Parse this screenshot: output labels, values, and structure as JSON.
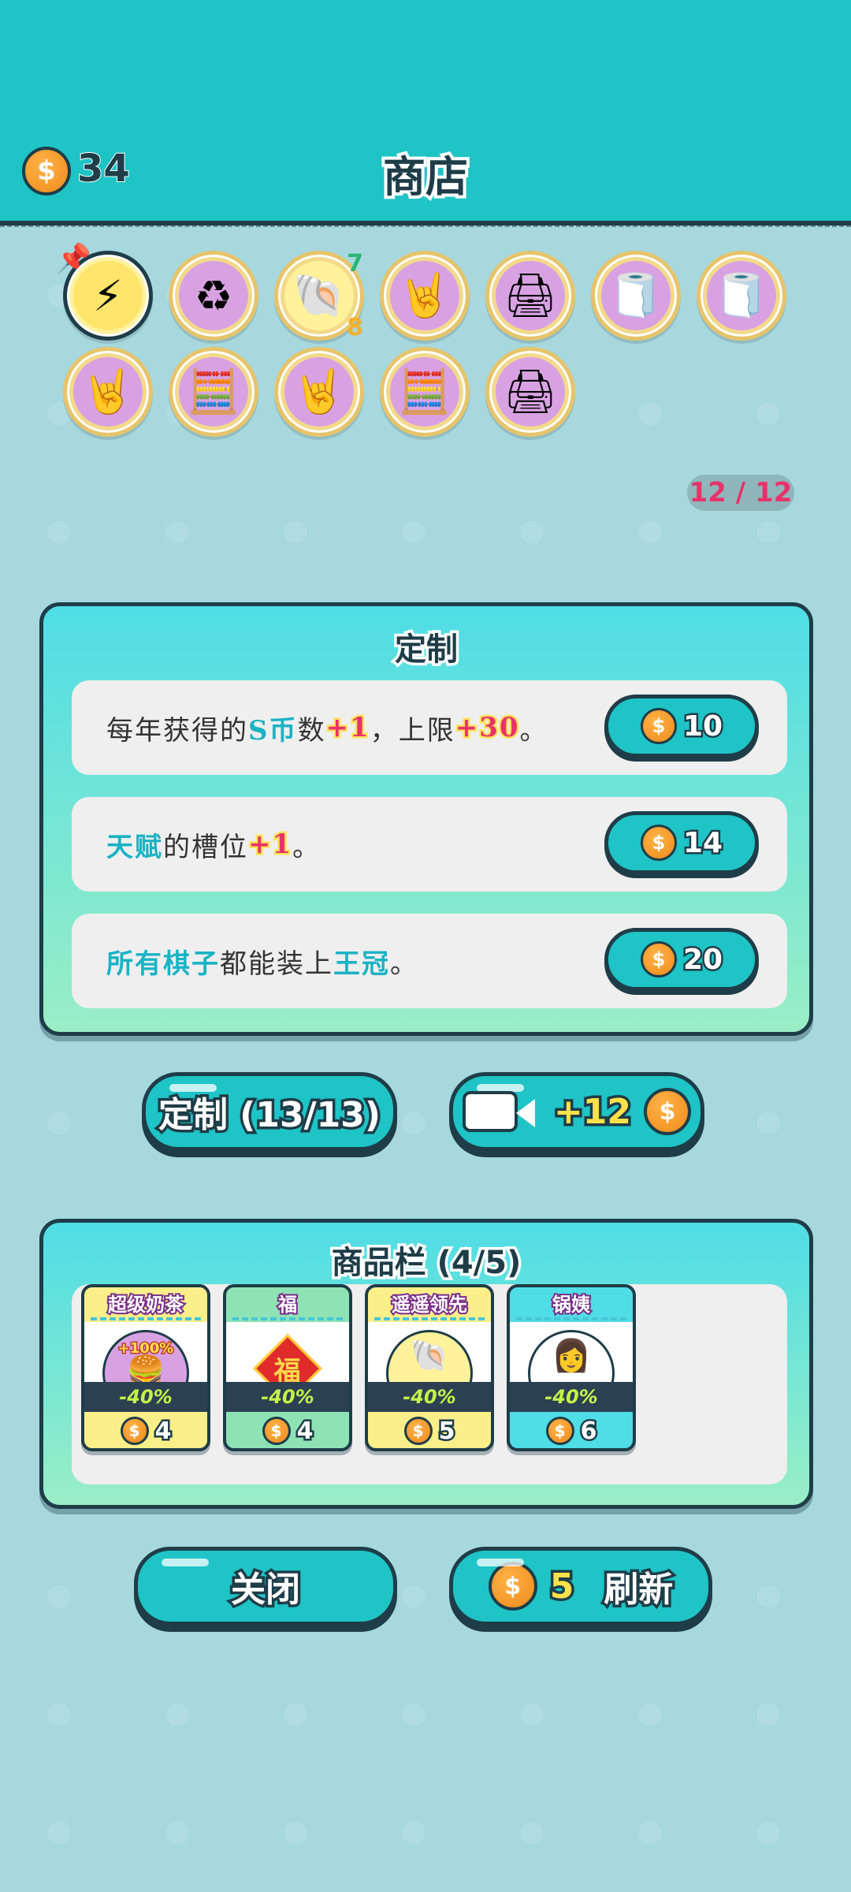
{
  "header": {
    "coins": "34",
    "title": "商店",
    "coin_symbol": "$"
  },
  "inventory": {
    "slots": [
      {
        "icon": "lightning-icon",
        "glyph": "⚡",
        "bg": "featured"
      },
      {
        "icon": "recycle-icon",
        "glyph": "♻",
        "bg": "purple"
      },
      {
        "icon": "shell-icon",
        "glyph": "🐚",
        "bg": "yellow",
        "badge_top": "7",
        "badge_bottom": "8"
      },
      {
        "icon": "rock-hand-icon",
        "glyph": "🤘",
        "bg": "purple"
      },
      {
        "icon": "printer-icon",
        "glyph": "🖨",
        "bg": "purple"
      },
      {
        "icon": "tissue-box-icon",
        "glyph": "🧻",
        "bg": "purple"
      },
      {
        "icon": "tissue-box-icon",
        "glyph": "🧻",
        "bg": "purple"
      },
      {
        "icon": "rock-hand-icon",
        "glyph": "🤘",
        "bg": "purple"
      },
      {
        "icon": "math-head-icon",
        "glyph": "🧮",
        "bg": "purple"
      },
      {
        "icon": "rock-hand-icon",
        "glyph": "🤘",
        "bg": "purple"
      },
      {
        "icon": "math-head-icon",
        "glyph": "🧮",
        "bg": "purple"
      },
      {
        "icon": "printer-icon",
        "glyph": "🖨",
        "bg": "purple"
      }
    ],
    "count": "12 / 12"
  },
  "custom_panel": {
    "title": "定制",
    "rows": [
      {
        "parts": [
          "每年获得的",
          "S币",
          "数",
          "+1",
          "，上限",
          "+30",
          "。"
        ],
        "price": "10"
      },
      {
        "parts": [
          "天赋",
          "的槽位",
          "+1",
          "。"
        ],
        "price": "14"
      },
      {
        "parts": [
          "所有棋子",
          "都能装上",
          "王冠",
          "。"
        ],
        "price": "20"
      }
    ]
  },
  "actions": {
    "custom_button": "定制 (13/13)",
    "video_reward": "+12"
  },
  "goods_panel": {
    "title": "商品栏 (4/5)",
    "cards": [
      {
        "name": "超级奶茶",
        "glyph": "🍔",
        "art_label": "+100%",
        "discount": "-40%",
        "price": "4",
        "color": "#fbef8a",
        "art_bg": "#d8a2e2"
      },
      {
        "name": "福",
        "glyph": "福",
        "discount": "-40%",
        "price": "4",
        "color": "#8ee3b5",
        "art_bg": "#ffffff"
      },
      {
        "name": "遥遥领先",
        "glyph": "🐚",
        "discount": "-40%",
        "price": "5",
        "color": "#fbef8a",
        "art_bg": "#fff29a"
      },
      {
        "name": "锅姨",
        "glyph": "👩",
        "discount": "-40%",
        "price": "6",
        "color": "#4fdde6",
        "art_bg": "#ffffff"
      }
    ]
  },
  "bottom": {
    "close_button": "关闭",
    "refresh_cost": "5",
    "refresh_button": "刷新"
  },
  "colors": {
    "accent": "#1ec4c6",
    "outline": "#1e3d48",
    "highlight": "#e8326b",
    "coin": "#f08a1c"
  }
}
